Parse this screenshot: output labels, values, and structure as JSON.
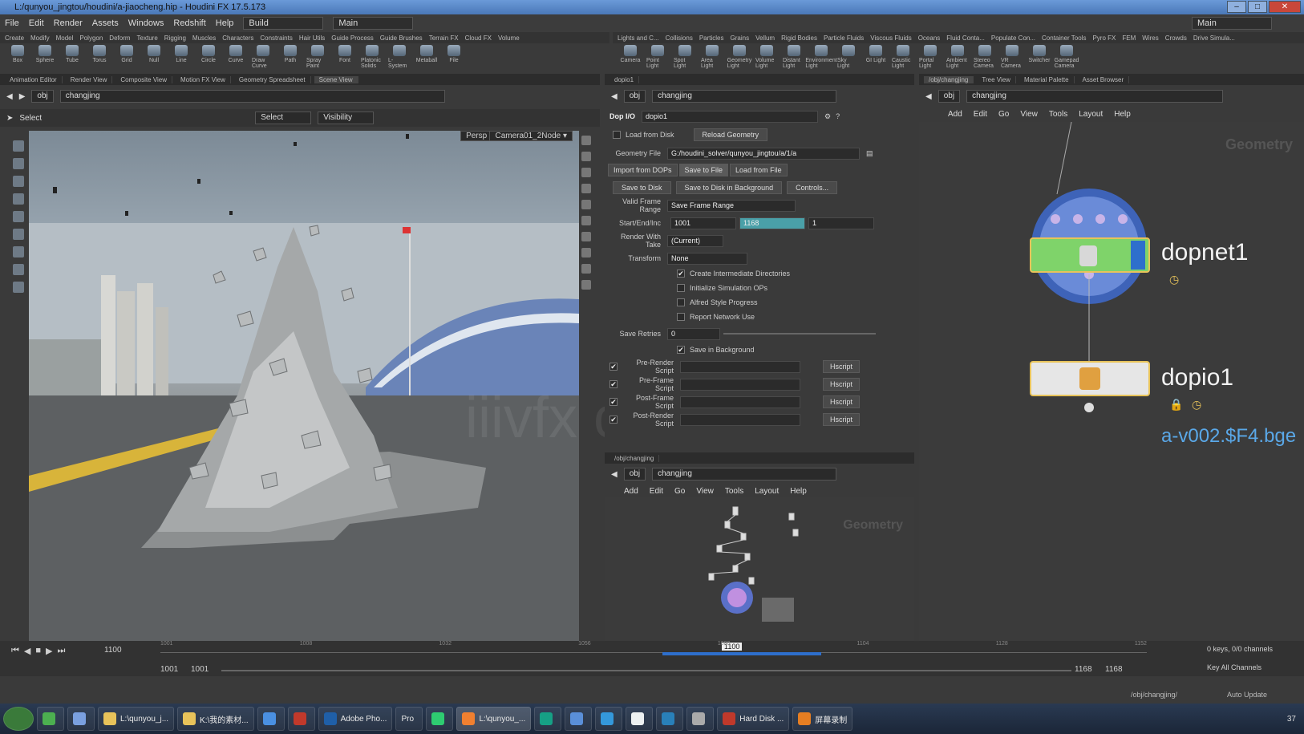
{
  "window": {
    "title": "L:/qunyou_jingtou/houdini/a-jiaocheng.hip - Houdini FX 17.5.173",
    "min": "–",
    "max": "□",
    "close": "✕"
  },
  "menu": {
    "items": [
      "File",
      "Edit",
      "Render",
      "Assets",
      "Windows",
      "Redshift",
      "Help"
    ],
    "build": "Build",
    "main": "Main",
    "main_right": "Main"
  },
  "shelf_left": {
    "tabs": [
      "Create",
      "Modify",
      "Model",
      "Polygon",
      "Deform",
      "Texture",
      "Rigging",
      "Muscles",
      "Characters",
      "Constraints",
      "Hair Utils",
      "Guide Process",
      "Guide Brushes",
      "Terrain FX",
      "Cloud FX",
      "Volume"
    ],
    "tools": [
      "Box",
      "Sphere",
      "Tube",
      "Torus",
      "Grid",
      "Null",
      "Line",
      "Circle",
      "Curve",
      "Draw Curve",
      "Path",
      "Spray Paint",
      "Font",
      "Platonic Solids",
      "L-System",
      "Metaball",
      "File"
    ]
  },
  "shelf_right": {
    "tabs": [
      "Lights and C...",
      "Collisions",
      "Particles",
      "Grains",
      "Vellum",
      "Rigid Bodies",
      "Particle Fluids",
      "Viscous Fluids",
      "Oceans",
      "Fluid Conta...",
      "Populate Con...",
      "Container Tools",
      "Pyro FX",
      "FEM",
      "Wires",
      "Crowds",
      "Drive Simula..."
    ],
    "tools": [
      "Camera",
      "Point Light",
      "Spot Light",
      "Area Light",
      "Geometry Light",
      "Volume Light",
      "Distant Light",
      "Environment Light",
      "Sky Light",
      "GI Light",
      "Caustic Light",
      "Portal Light",
      "Ambient Light",
      "Stereo Camera",
      "VR Camera",
      "Switcher",
      "Gamepad Camera"
    ]
  },
  "viewer": {
    "tabs": [
      "Animation Editor",
      "Render View",
      "Composite View",
      "Motion FX View",
      "Geometry Spreadsheet",
      "Scene View"
    ],
    "path_obj": "obj",
    "path_node": "changjing",
    "select": "Select",
    "select_dd": "Select",
    "visibility": "Visibility",
    "persp": "Persp ▾",
    "cam": "Camera01_2Node ▾"
  },
  "params": {
    "tabs": [
      "dopio1"
    ],
    "path_obj": "obj",
    "path_node": "changjing",
    "node_type": "Dop I/O",
    "node_name": "dopio1",
    "load_from_disk": "Load from Disk",
    "reload": "Reload Geometry",
    "geo_file_label": "Geometry File",
    "geo_file": "G:/houdini_solver/qunyou_jingtou/a/1/a",
    "subtabs": [
      "Import from DOPs",
      "Save to File",
      "Load from File"
    ],
    "save_to_disk": "Save to Disk",
    "save_bg": "Save to Disk in Background",
    "controls": "Controls...",
    "valid_frame_label": "Valid Frame Range",
    "valid_frame": "Save Frame Range",
    "start_label": "Start/End/Inc",
    "start": "1001",
    "end": "1168",
    "inc": "1",
    "take_label": "Render With Take",
    "take": "(Current)",
    "transform_label": "Transform",
    "transform": "None",
    "checks": [
      "Create Intermediate Directories",
      "Initialize Simulation OPs",
      "Alfred Style Progress",
      "Report Network Use"
    ],
    "checks_on": [
      true,
      false,
      false,
      false
    ],
    "retries_label": "Save Retries",
    "retries": "0",
    "save_in_bg": "Save in Background",
    "scripts": [
      "Pre-Render Script",
      "Pre-Frame Script",
      "Post-Frame Script",
      "Post-Render Script"
    ],
    "hscript": "Hscript"
  },
  "net_right": {
    "tabs": [
      "/obj/changjing",
      "Tree View",
      "Material Palette",
      "Asset Browser"
    ],
    "path_obj": "obj",
    "path_node": "changjing",
    "menu": [
      "Add",
      "Edit",
      "Go",
      "View",
      "Tools",
      "Layout",
      "Help"
    ],
    "context": "Geometry",
    "node1": "dopnet1",
    "node2": "dopio1",
    "node2_sub": "a-v002.$F4.bge"
  },
  "net_bottom": {
    "tabs": [
      "/obj/changjing"
    ],
    "path_obj": "obj",
    "path_node": "changjing",
    "menu": [
      "Add",
      "Edit",
      "Go",
      "View",
      "Tools",
      "Layout",
      "Help"
    ],
    "context": "Geometry"
  },
  "timeline": {
    "frame": "1100",
    "marker": "1100",
    "ticks": [
      "1001",
      "1008",
      "1032",
      "1056",
      "1080",
      "1104",
      "1128",
      "1152"
    ],
    "range_start": "1001",
    "range_start2": "1001",
    "range_end": "1168",
    "range_end2": "1168",
    "keys": "0 keys, 0/0 channels",
    "key_all": "Key All Channels",
    "path": "/obj/changjing/",
    "auto_update": "Auto Update"
  },
  "watermark": "iiivfx.com",
  "taskbar": {
    "items": [
      "L:\\qunyou_j...",
      "K:\\我的素材...",
      "Adobe Pho...",
      "Pro",
      "L:\\qunyou_...",
      "Hard Disk ...",
      "屏幕录制"
    ],
    "clock": "37"
  },
  "colors": {
    "accent_blue": "#2e6fcc",
    "node_green": "#7fd36a",
    "node_yellow": "#e8c35a",
    "title_bar": "#5a88c8"
  }
}
